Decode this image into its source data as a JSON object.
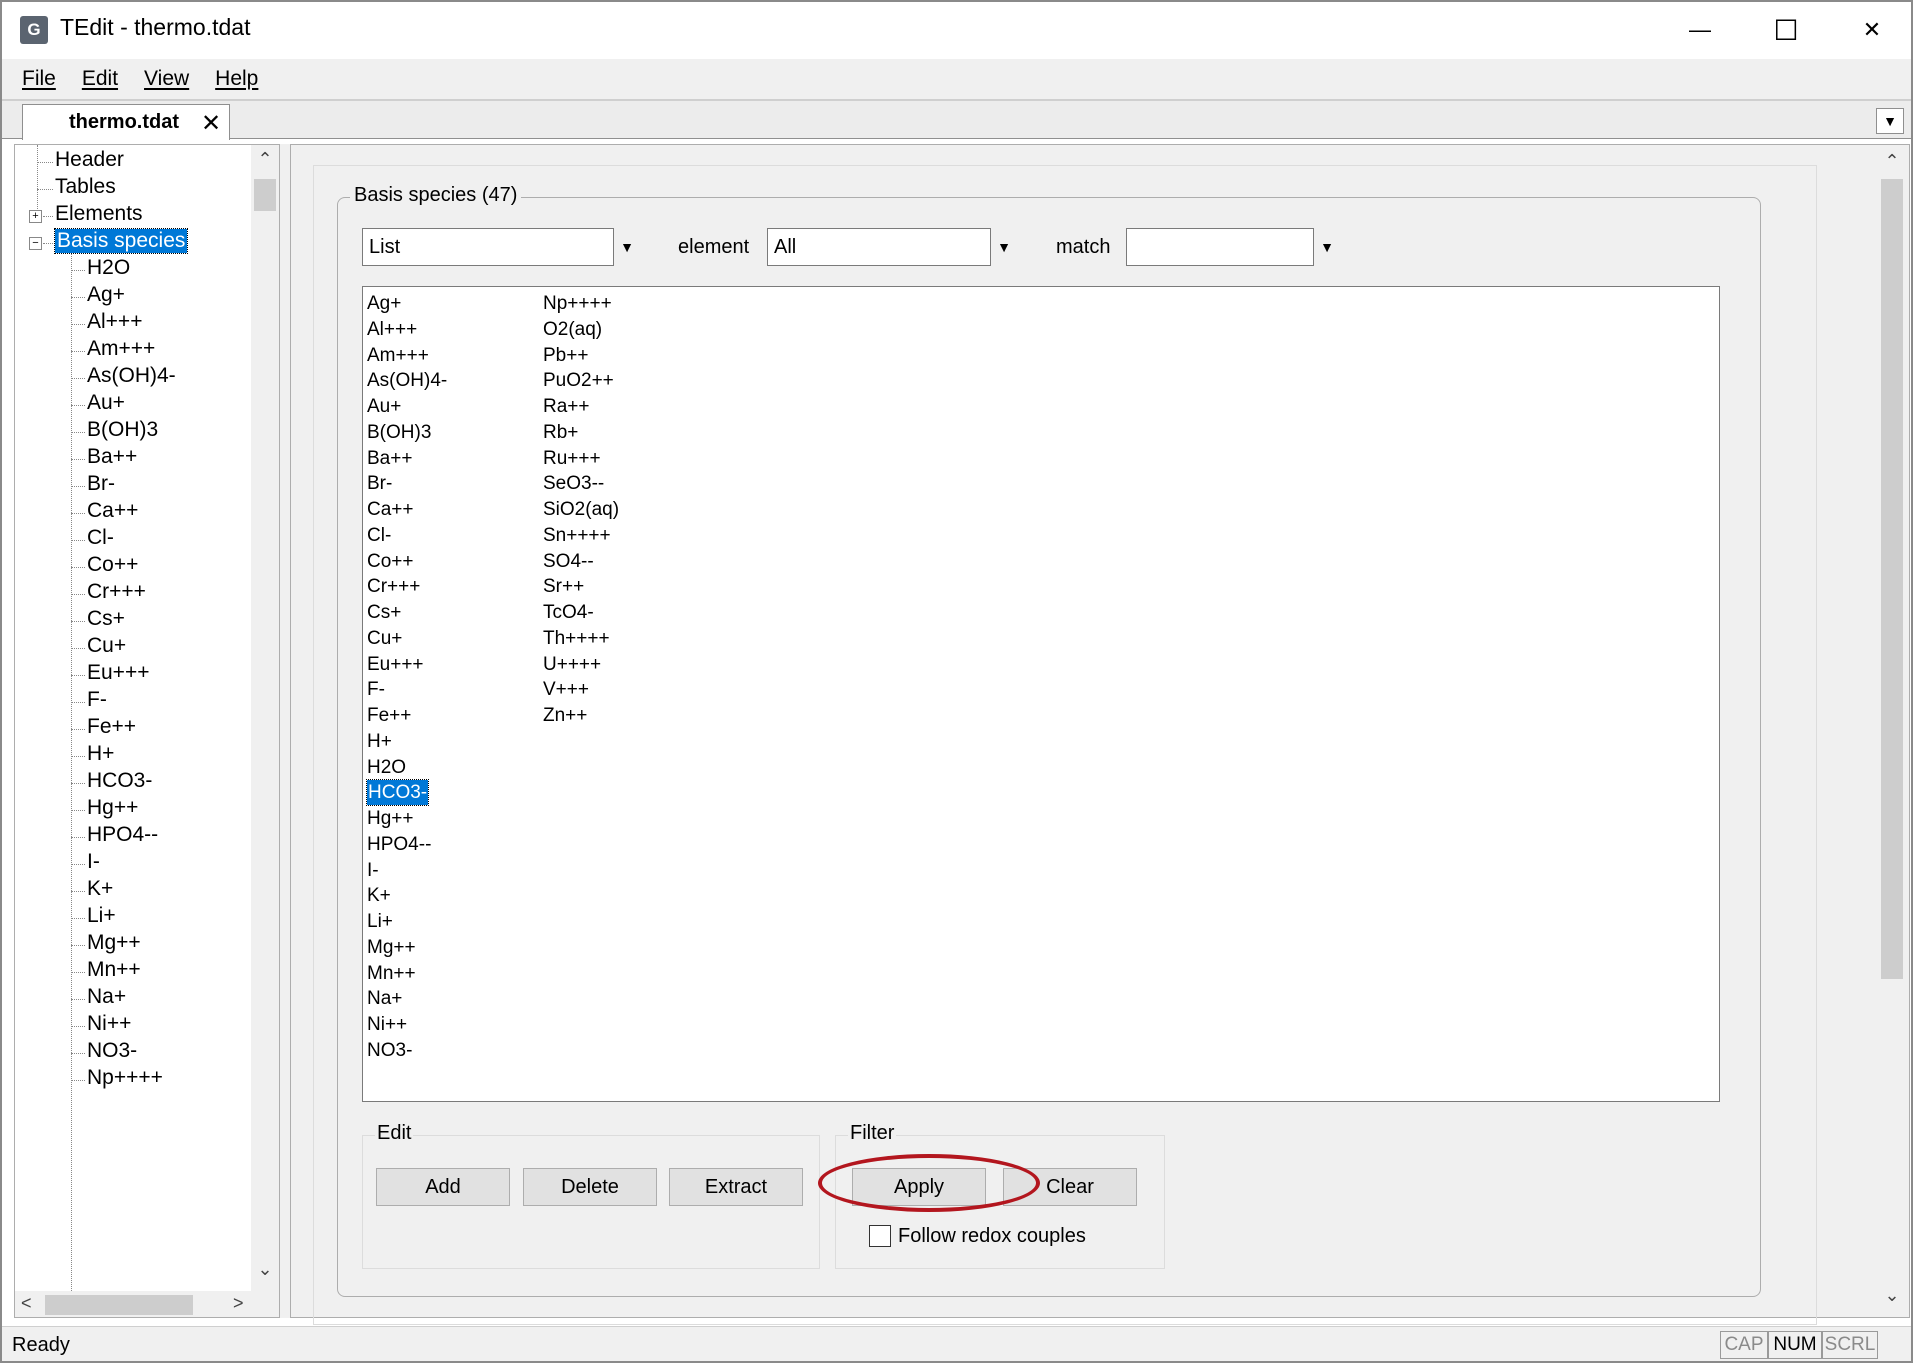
{
  "window": {
    "app_icon_glyph": "G",
    "title": "TEdit - thermo.tdat",
    "min_glyph": "—",
    "max_glyph": "☐",
    "close_glyph": "✕"
  },
  "menu": [
    "File",
    "Edit",
    "View",
    "Help"
  ],
  "tab": {
    "label": "thermo.tdat",
    "close_glyph": "✕",
    "dropdown_glyph": "▼"
  },
  "tree": {
    "top_items": [
      "Header",
      "Tables",
      "Elements",
      "Basis species"
    ],
    "expander_collapsed": "+",
    "expander_expanded": "−",
    "children": [
      "H2O",
      "Ag+",
      "Al+++",
      "Am+++",
      "As(OH)4-",
      "Au+",
      "B(OH)3",
      "Ba++",
      "Br-",
      "Ca++",
      "Cl-",
      "Co++",
      "Cr+++",
      "Cs+",
      "Cu+",
      "Eu+++",
      "F-",
      "Fe++",
      "H+",
      "HCO3-",
      "Hg++",
      "HPO4--",
      "I-",
      "K+",
      "Li+",
      "Mg++",
      "Mn++",
      "Na+",
      "Ni++",
      "NO3-",
      "Np++++"
    ]
  },
  "scroll_glyphs": {
    "up": "⌃",
    "down": "⌄",
    "left": "<",
    "right": ">"
  },
  "basis_panel": {
    "title": "Basis species (47)",
    "view_combo": {
      "value": "List",
      "arrow": "▼"
    },
    "element_label": "element",
    "element_combo": {
      "value": "All",
      "arrow": "▼"
    },
    "match_label": "match",
    "match_combo": {
      "value": "",
      "arrow": "▼"
    },
    "species_columns": [
      [
        "Ag+",
        "Al+++",
        "Am+++",
        "As(OH)4-",
        "Au+",
        "B(OH)3",
        "Ba++",
        "Br-",
        "Ca++",
        "Cl-",
        "Co++",
        "Cr+++",
        "Cs+",
        "Cu+",
        "Eu+++",
        "F-",
        "Fe++",
        "H+",
        "H2O",
        "HCO3-",
        "Hg++",
        "HPO4--",
        "I-",
        "K+",
        "Li+",
        "Mg++",
        "Mn++",
        "Na+",
        "Ni++",
        "NO3-"
      ],
      [
        "Np++++",
        "O2(aq)",
        "Pb++",
        "PuO2++",
        "Ra++",
        "Rb+",
        "Ru+++",
        "SeO3--",
        "SiO2(aq)",
        "Sn++++",
        "SO4--",
        "Sr++",
        "TcO4-",
        "Th++++",
        "U++++",
        "V+++",
        "Zn++"
      ]
    ],
    "selected_species": "HCO3-",
    "edit_group": {
      "title": "Edit",
      "add": "Add",
      "delete": "Delete",
      "extract": "Extract"
    },
    "filter_group": {
      "title": "Filter",
      "apply": "Apply",
      "clear": "Clear",
      "follow_redox": "Follow redox couples",
      "follow_redox_checked": false
    }
  },
  "status": {
    "text": "Ready",
    "indicators": [
      "CAP",
      "NUM",
      "SCRL"
    ]
  },
  "colors": {
    "selection": "#0078d7",
    "annotation": "#b3161e"
  }
}
